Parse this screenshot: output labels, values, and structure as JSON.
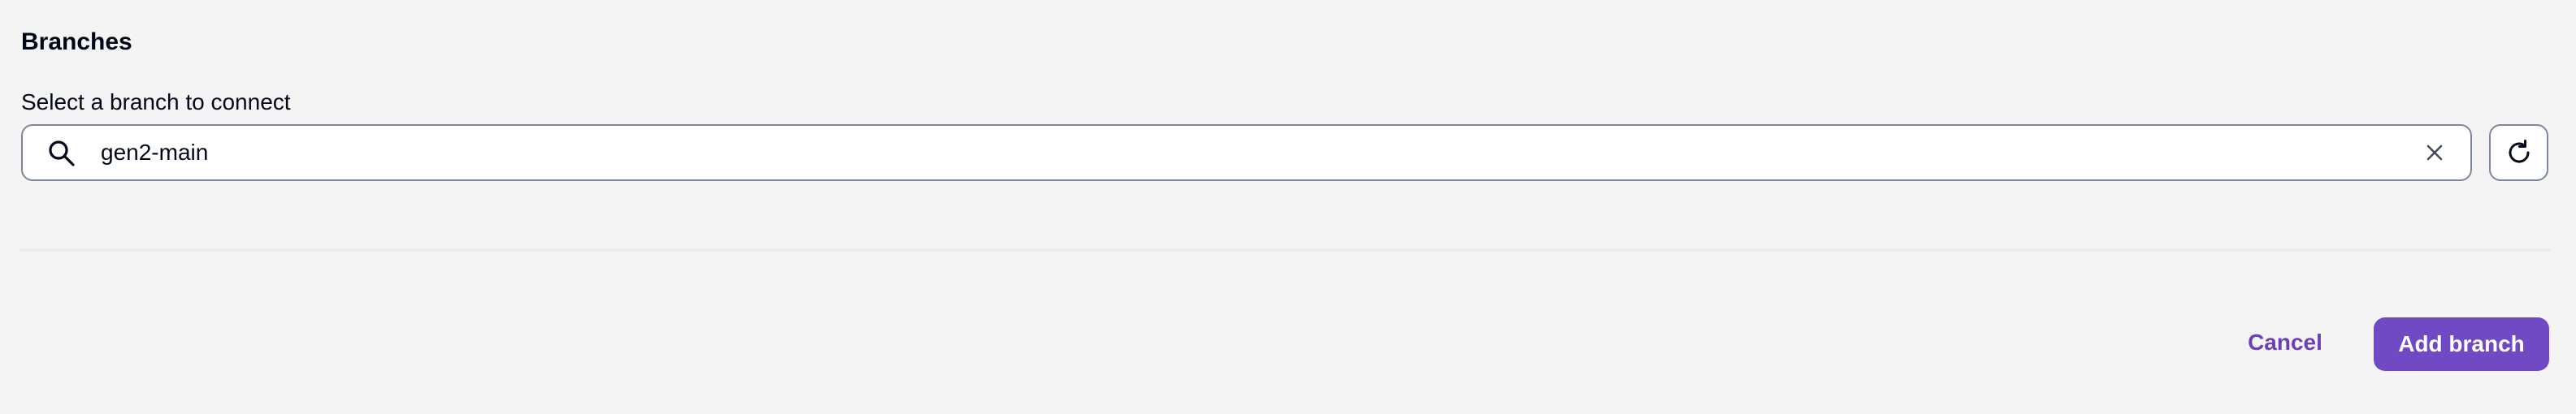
{
  "section": {
    "title": "Branches"
  },
  "branch_select": {
    "label": "Select a branch to connect",
    "value": "gen2-main",
    "search_icon": "search-icon",
    "clear_icon": "close-icon",
    "refresh_icon": "refresh-icon"
  },
  "actions": {
    "cancel_label": "Cancel",
    "add_label": "Add branch"
  },
  "colors": {
    "accent": "#7049c4",
    "accent_text": "#6b40b8",
    "background": "#f4f4f4",
    "border": "#7d8998"
  }
}
